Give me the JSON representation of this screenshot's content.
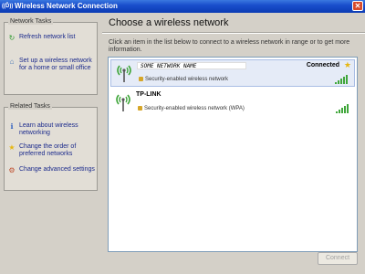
{
  "window": {
    "title": "Wireless Network Connection",
    "app_icon": "((Ď))"
  },
  "sidebar": {
    "network_tasks": {
      "title": "Network Tasks",
      "items": [
        {
          "label": "Refresh network list",
          "icon": "refresh-icon"
        },
        {
          "label": "Set up a wireless network for a home or small office",
          "icon": "setup-wireless-icon"
        }
      ]
    },
    "related_tasks": {
      "title": "Related Tasks",
      "items": [
        {
          "label": "Learn about wireless networking",
          "icon": "info-icon"
        },
        {
          "label": "Change the order of preferred networks",
          "icon": "star-icon"
        },
        {
          "label": "Change advanced settings",
          "icon": "settings-icon"
        }
      ]
    }
  },
  "main": {
    "heading": "Choose a wireless network",
    "instructions": "Click an item in the list below to connect to a wireless network in range or to get more information.",
    "networks": [
      {
        "name": "SOME NETWORK NAME",
        "security": "Security-enabled wireless network",
        "status": "Connected",
        "preferred": true,
        "signal_bars": 5
      },
      {
        "name": "TP-LINK",
        "security": "Security-enabled wireless network (WPA)",
        "status": "",
        "preferred": false,
        "signal_bars": 5
      }
    ],
    "connect_label": "Connect"
  },
  "colors": {
    "title_bar": "#1a4fcc",
    "signal_green": "#3fa63a",
    "link_blue": "#1b2a8c",
    "star_yellow": "#e6b711"
  }
}
